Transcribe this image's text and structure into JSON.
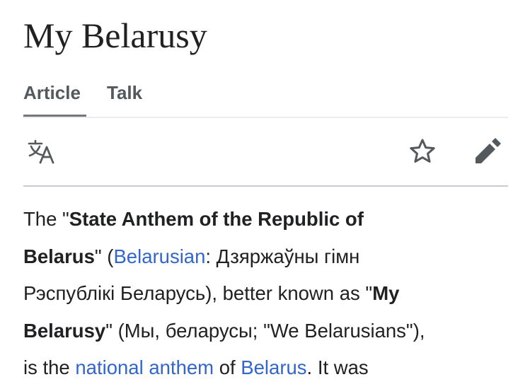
{
  "page": {
    "title": "My Belarusy"
  },
  "tabs": [
    {
      "label": "Article"
    },
    {
      "label": "Talk"
    }
  ],
  "toolbar": {
    "language_icon": "translate-icon",
    "watch_icon": "star-icon",
    "edit_icon": "pencil-icon"
  },
  "colors": {
    "link": "#3366cc",
    "text": "#202122",
    "tab_text": "#54595d",
    "tab_active_underline": "#72777d",
    "icon": "#54595d"
  },
  "article": {
    "lines": [
      {
        "segments": [
          {
            "text": "The \"",
            "style": "plain"
          },
          {
            "text": "State Anthem of the Republic of",
            "style": "bold"
          }
        ]
      },
      {
        "segments": [
          {
            "text": "Belarus",
            "style": "bold"
          },
          {
            "text": "\" (",
            "style": "plain"
          },
          {
            "text": "Belarusian",
            "style": "link"
          },
          {
            "text": ": Дзяржаўны гімн",
            "style": "plain"
          }
        ]
      },
      {
        "segments": [
          {
            "text": "Рэспублікі Беларусь), better known as \"",
            "style": "plain"
          },
          {
            "text": "My",
            "style": "bold"
          }
        ]
      },
      {
        "segments": [
          {
            "text": "Belarusy",
            "style": "bold"
          },
          {
            "text": "\" (Мы, беларусы; \"We Belarusians\"),",
            "style": "plain"
          }
        ]
      },
      {
        "segments": [
          {
            "text": "is the ",
            "style": "plain"
          },
          {
            "text": "national anthem",
            "style": "link"
          },
          {
            "text": " of ",
            "style": "plain"
          },
          {
            "text": "Belarus",
            "style": "link"
          },
          {
            "text": ". It was",
            "style": "plain"
          }
        ]
      }
    ]
  }
}
